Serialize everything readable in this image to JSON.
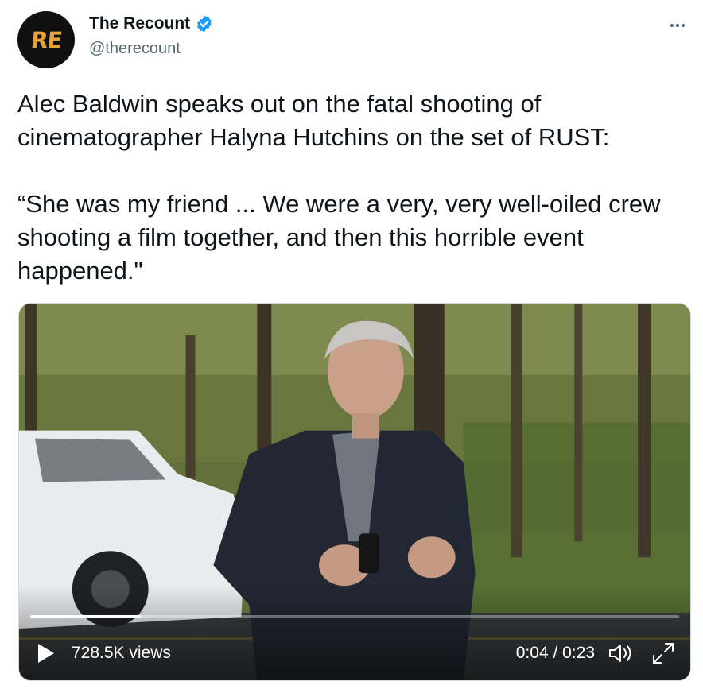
{
  "account": {
    "avatar_text": "RE",
    "display_name": "The Recount",
    "handle": "@therecount",
    "verified": true
  },
  "tweet": {
    "text": "Alec Baldwin speaks out on the fatal shooting of cinematographer Halyna Hutchins on the set of RUST:\n\n“She was my friend ... We were a very, very well-oiled crew shooting a film together, and then this horrible event happened.\""
  },
  "video": {
    "views": "728.5K views",
    "time": "0:04 / 0:23",
    "progress_fraction": 0.17
  },
  "icons": {
    "more": "more-icon",
    "verified": "verified-badge-icon",
    "play": "play-icon",
    "volume": "volume-icon",
    "expand": "expand-icon"
  },
  "colors": {
    "verified_blue": "#1d9bf0",
    "avatar_bg": "#101010",
    "avatar_fg": "#e8a23a",
    "handle_gray": "#536471"
  }
}
